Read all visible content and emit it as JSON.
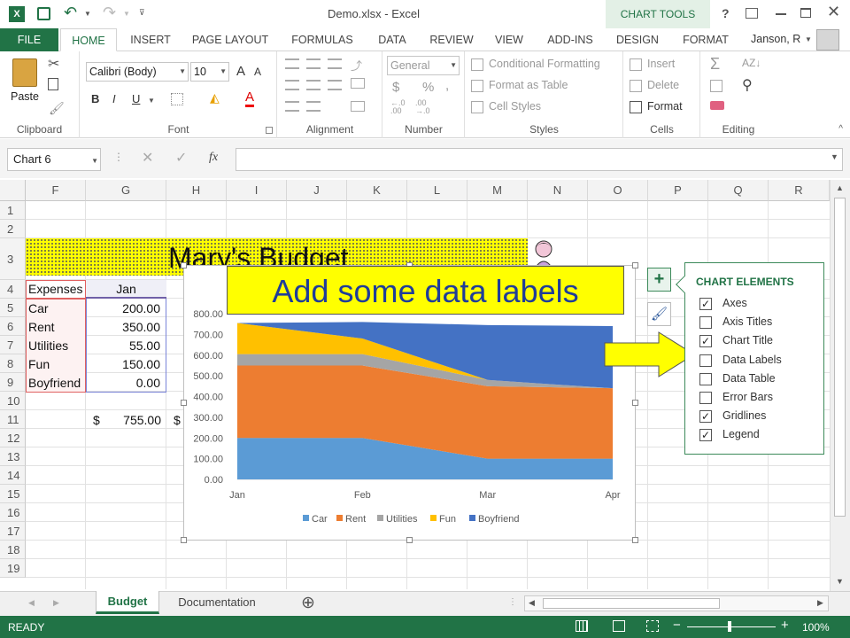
{
  "titlebar": {
    "title": "Demo.xlsx - Excel",
    "chart_tools": "CHART TOOLS",
    "help": "?",
    "user": "Janson, R"
  },
  "tabs": [
    "FILE",
    "HOME",
    "INSERT",
    "PAGE LAYOUT",
    "FORMULAS",
    "DATA",
    "REVIEW",
    "VIEW",
    "ADD-INS",
    "DESIGN",
    "FORMAT"
  ],
  "ribbon": {
    "paste": "Paste",
    "clipboard": "Clipboard",
    "font_name": "Calibri (Body)",
    "font_size": "10",
    "font": "Font",
    "alignment": "Alignment",
    "number_format": "General",
    "number": "Number",
    "conditional_formatting": "Conditional Formatting",
    "format_as_table": "Format as Table",
    "cell_styles": "Cell Styles",
    "styles": "Styles",
    "insert": "Insert",
    "delete": "Delete",
    "format": "Format",
    "cells": "Cells",
    "editing": "Editing",
    "bold": "B",
    "italic": "I",
    "underline": "U",
    "dollar": "$",
    "percent": "%",
    "decimals_up": "←.0\n.00",
    "sigma": "Σ",
    "font_grow": "A",
    "font_shrink": "A"
  },
  "formula_bar": {
    "name_box": "Chart 6",
    "fx": "fx",
    "value": ""
  },
  "columns": [
    "F",
    "G",
    "H",
    "I",
    "J",
    "K",
    "L",
    "M",
    "N",
    "O",
    "P",
    "Q",
    "R"
  ],
  "rows": [
    "1",
    "2",
    "3",
    "4",
    "5",
    "6",
    "7",
    "8",
    "9",
    "10",
    "11",
    "12",
    "13",
    "14",
    "15",
    "16",
    "17",
    "18",
    "19"
  ],
  "sheet": {
    "title": "Mary's Budget",
    "header_expenses": "Expenses",
    "header_jan": "Jan",
    "items": [
      "Car",
      "Rent",
      "Utilities",
      "Fun",
      "Boyfriend"
    ],
    "jan_values": [
      "200.00",
      "350.00",
      "55.00",
      "150.00",
      "0.00"
    ],
    "total_currency": "$",
    "total_value": "755.00",
    "total_currency2": "$"
  },
  "callout": "Add some data labels",
  "chart_elements": {
    "title": "CHART ELEMENTS",
    "items": [
      {
        "label": "Axes",
        "checked": true
      },
      {
        "label": "Axis Titles",
        "checked": false
      },
      {
        "label": "Chart Title",
        "checked": true
      },
      {
        "label": "Data Labels",
        "checked": false
      },
      {
        "label": "Data Table",
        "checked": false
      },
      {
        "label": "Error Bars",
        "checked": false
      },
      {
        "label": "Gridlines",
        "checked": true
      },
      {
        "label": "Legend",
        "checked": true
      }
    ],
    "plus": "+",
    "check": "✓"
  },
  "sheet_tabs": {
    "active": "Budget",
    "other": "Documentation",
    "add": "⊕"
  },
  "status": {
    "ready": "READY",
    "zoom": "100%"
  },
  "colors": {
    "excel_green": "#217346",
    "car": "#5b9bd5",
    "rent": "#ed7d31",
    "utilities": "#a5a5a5",
    "fun": "#ffc000",
    "boyfriend": "#4472c4",
    "callout_bg": "#ffff00"
  },
  "chart_data": {
    "type": "area",
    "stacked": true,
    "categories": [
      "Jan",
      "Feb",
      "Mar",
      "Apr"
    ],
    "series": [
      {
        "name": "Car",
        "values": [
          200,
          200,
          100,
          100
        ]
      },
      {
        "name": "Rent",
        "values": [
          350,
          350,
          350,
          340
        ]
      },
      {
        "name": "Utilities",
        "values": [
          55,
          55,
          30,
          0
        ]
      },
      {
        "name": "Fun",
        "values": [
          150,
          75,
          0,
          0
        ]
      },
      {
        "name": "Boyfriend",
        "values": [
          0,
          80,
          265,
          300
        ]
      }
    ],
    "y_ticks": [
      "800.00",
      "700.00",
      "600.00",
      "500.00",
      "400.00",
      "300.00",
      "200.00",
      "100.00",
      "0.00"
    ],
    "ylim": [
      0,
      800
    ],
    "grid": true,
    "legend": "bottom"
  }
}
